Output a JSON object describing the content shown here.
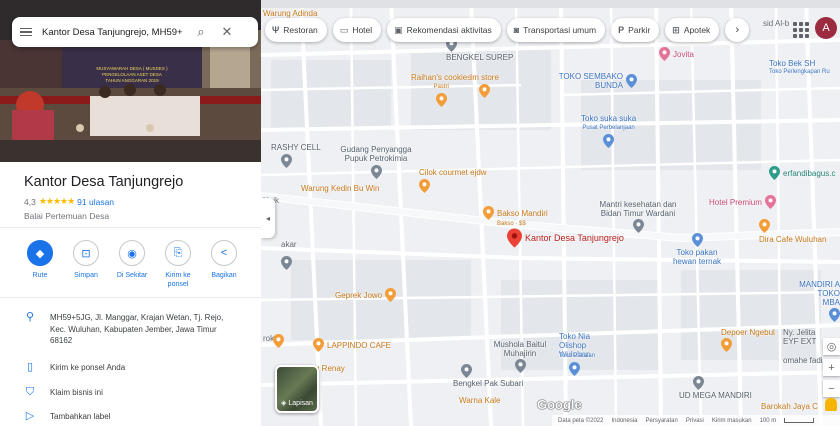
{
  "search": {
    "value": "Kantor Desa Tanjungrejo, MH59+"
  },
  "photo_banner": [
    "MUSYAWARAH DESA ( MUSDES )",
    "PENGELOLAAN ASET DESA",
    "TAHUN ANGGARAN 2019"
  ],
  "place": {
    "title": "Kantor Desa Tanjungrejo",
    "rating": "4,3",
    "stars": "★★★★★",
    "reviews": "91 ulasan",
    "category": "Balai Pertemuan Desa"
  },
  "actions": [
    {
      "icon": "◆",
      "label": "Rute"
    },
    {
      "icon": "⊡",
      "label": "Simpan"
    },
    {
      "icon": "◉",
      "label": "Di Sekitar"
    },
    {
      "icon": "⎘",
      "label": "Kirim ke ponsel"
    },
    {
      "icon": "<",
      "label": "Bagikan"
    }
  ],
  "info": {
    "address": "MH59+5JG, Jl. Manggar, Krajan Wetan, Tj. Rejo, Kec. Wuluhan, Kabupaten Jember, Jawa Timur 68162",
    "send_to_phone": "Kirim ke ponsel Anda",
    "claim": "Klaim bisnis ini",
    "add_label": "Tambahkan label"
  },
  "chips": [
    {
      "icon": "Ψ",
      "label": "Restoran"
    },
    {
      "icon": "▭",
      "label": "Hotel"
    },
    {
      "icon": "▣",
      "label": "Rekomendasi aktivitas"
    },
    {
      "icon": "◙",
      "label": "Transportasi umum"
    },
    {
      "icon": "P",
      "label": "Parkir"
    },
    {
      "icon": "⊞",
      "label": "Apotek"
    }
  ],
  "chips_more": "›",
  "account_initial": "A",
  "layers_label": "Lapisan",
  "brand": "Google",
  "footer": {
    "data": "Data peta ©2022",
    "country": "Indonesia",
    "terms": "Persyaratan",
    "privacy": "Privasi",
    "feedback": "Kirim masukan",
    "scale": "100 m"
  },
  "map": {
    "selected": "Kantor Desa Tanjungrejo",
    "pois": [
      {
        "name": "Warung Adinda",
        "color": "orange"
      },
      {
        "name": "BENGKEL SUREP",
        "color": "grey"
      },
      {
        "name": "Jovita",
        "color": "pink"
      },
      {
        "name": "Raihan's cookies",
        "sub": "Pastri",
        "color": "orange"
      },
      {
        "name": "Im store",
        "color": "orange"
      },
      {
        "name": "TOKO SEMBAKO BUNDA",
        "color": "blue"
      },
      {
        "name": "Toko Bek SH",
        "sub": "Toko Perlengkapan Ru",
        "color": "blue"
      },
      {
        "name": "Toko suka suka",
        "sub": "Pusat Perbelanjaan",
        "color": "blue"
      },
      {
        "name": "RASHY CELL",
        "color": "grey"
      },
      {
        "name": "Gudang Penyangga Pupuk Petrokimia",
        "color": "grey"
      },
      {
        "name": "erfandibagus.c",
        "color": "green"
      },
      {
        "name": "Cilok courmet ejdw",
        "color": "orange"
      },
      {
        "name": "Warung Kedin Bu Win",
        "color": "orange"
      },
      {
        "name": "Hotel Premium",
        "color": "pink"
      },
      {
        "name": "Bakso Mandiri",
        "sub": "Bakso · $$",
        "color": "orange"
      },
      {
        "name": "Mantri kesehatan dan Bidan Timur Wardani",
        "color": "grey"
      },
      {
        "name": "Dira Cafe Wuluhan",
        "color": "orange"
      },
      {
        "name": "Toko pakan hewan ternak",
        "color": "blue"
      },
      {
        "name": "Geprek Jowo",
        "color": "orange"
      },
      {
        "name": "MANDIRI A TOKO MBA",
        "color": "blue"
      },
      {
        "name": "LAPPINDO CAFE",
        "color": "orange"
      },
      {
        "name": "Toko Nia Olishop Wuluhan",
        "color": "blue"
      },
      {
        "name": "Mushola Baitul Muhajirin",
        "color": "grey"
      },
      {
        "name": "Toko Pakaian",
        "color": "blue"
      },
      {
        "name": "Depoer Ngebul",
        "color": "orange"
      },
      {
        "name": "Ny. Jelita EYF EXT",
        "color": "grey"
      },
      {
        "name": "omahe fadi",
        "color": "grey"
      },
      {
        "name": "g Renay",
        "color": "orange"
      },
      {
        "name": "Bengkel Pak Subari",
        "color": "grey"
      },
      {
        "name": "Warna Kale",
        "color": "orange"
      },
      {
        "name": "UD MEGA MANDIRI",
        "color": "grey"
      },
      {
        "name": "Barokah Jaya C",
        "color": "orange"
      }
    ],
    "streets": [
      "Jl. Manggar"
    ],
    "edge_labels": [
      "akar",
      "Unik",
      "rok",
      "sid Al-b"
    ]
  }
}
